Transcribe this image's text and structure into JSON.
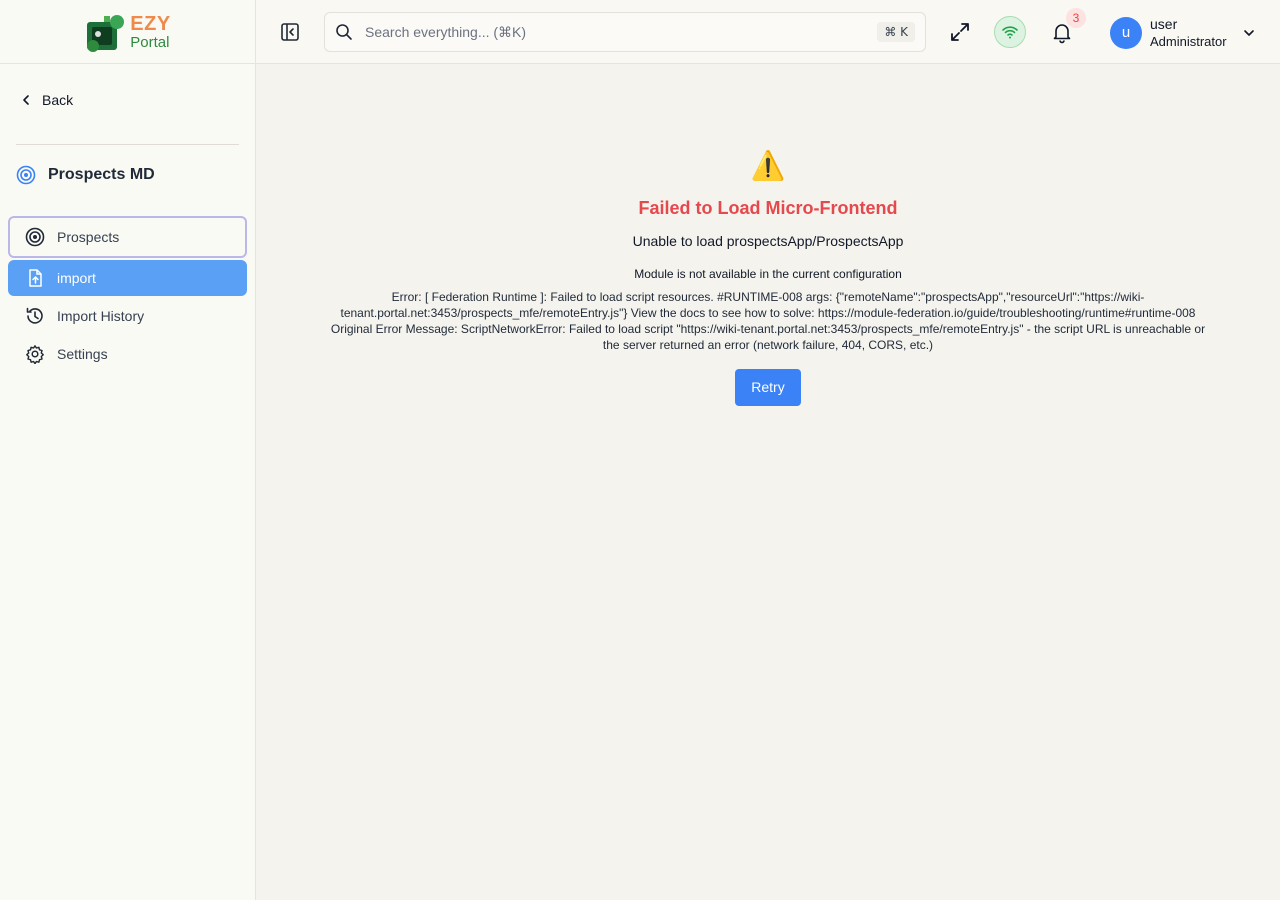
{
  "logo": {
    "line1": "EZY",
    "line2": "Portal"
  },
  "sidebar": {
    "back_label": "Back",
    "module_title": "Prospects MD",
    "items": [
      {
        "label": "Prospects",
        "icon": "target-icon",
        "state": "focused"
      },
      {
        "label": "import",
        "icon": "file-upload-icon",
        "state": "active"
      },
      {
        "label": "Import History",
        "icon": "history-icon",
        "state": "normal"
      },
      {
        "label": "Settings",
        "icon": "gear-icon",
        "state": "normal"
      }
    ]
  },
  "header": {
    "search_placeholder": "Search everything... (⌘K)",
    "search_shortcut": "⌘ K",
    "notification_count": "3",
    "user": {
      "avatar_letter": "u",
      "name": "user",
      "role": "Administrator"
    }
  },
  "error": {
    "icon": "⚠️",
    "title": "Failed to Load Micro-Frontend",
    "subtitle": "Unable to load prospectsApp/ProspectsApp",
    "module_message": "Module is not available in the current configuration",
    "detail": "Error: [ Federation Runtime ]: Failed to load script resources. #RUNTIME-008 args: {\"remoteName\":\"prospectsApp\",\"resourceUrl\":\"https://wiki-tenant.portal.net:3453/prospects_mfe/remoteEntry.js\"} View the docs to see how to solve: https://module-federation.io/guide/troubleshooting/runtime#runtime-008 Original Error Message: ScriptNetworkError: Failed to load script \"https://wiki-tenant.portal.net:3453/prospects_mfe/remoteEntry.js\" - the script URL is unreachable or the server returned an error (network failure, 404, CORS, etc.)",
    "retry_label": "Retry"
  },
  "colors": {
    "accent": "#3b82f6",
    "active_nav": "#5aa0f5",
    "error_red": "#e5484d",
    "online_green": "#22a34a"
  }
}
